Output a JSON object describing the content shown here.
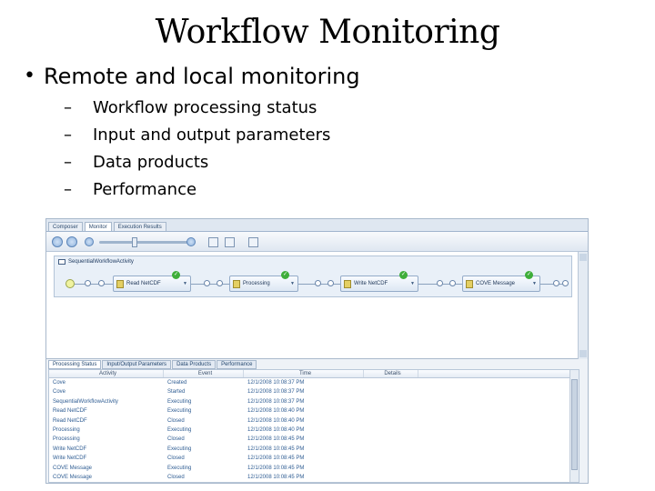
{
  "slide": {
    "title": "Workflow Monitoring",
    "bullet": "Remote and local monitoring",
    "subbullets": [
      "Workflow processing status",
      "Input and output parameters",
      "Data products",
      "Performance"
    ]
  },
  "app": {
    "tabs": [
      "Composer",
      "Monitor",
      "Execution Results"
    ],
    "active_tab": "Monitor",
    "workflow": {
      "name": "SequentialWorkflowActivity",
      "activities": [
        "Read NetCDF",
        "Processing",
        "Write NetCDF",
        "COVE Message"
      ]
    },
    "panel_tabs": [
      "Processing Status",
      "Input/Output Parameters",
      "Data Products",
      "Performance"
    ],
    "grid": {
      "columns": [
        "Activity",
        "Event",
        "Time",
        "Details"
      ],
      "rows": [
        [
          "Cove",
          "Created",
          "12/1/2008 10:08:37 PM",
          ""
        ],
        [
          "Cove",
          "Started",
          "12/1/2008 10:08:37 PM",
          ""
        ],
        [
          "SequentialWorkflowActivity",
          "Executing",
          "12/1/2008 10:08:37 PM",
          ""
        ],
        [
          "Read NetCDF",
          "Executing",
          "12/1/2008 10:08:40 PM",
          ""
        ],
        [
          "Read NetCDF",
          "Closed",
          "12/1/2008 10:08:40 PM",
          ""
        ],
        [
          "Processing",
          "Executing",
          "12/1/2008 10:08:40 PM",
          ""
        ],
        [
          "Processing",
          "Closed",
          "12/1/2008 10:08:45 PM",
          ""
        ],
        [
          "Write NetCDF",
          "Executing",
          "12/1/2008 10:08:45 PM",
          ""
        ],
        [
          "Write NetCDF",
          "Closed",
          "12/1/2008 10:08:45 PM",
          ""
        ],
        [
          "COVE Message",
          "Executing",
          "12/1/2008 10:08:45 PM",
          ""
        ],
        [
          "COVE Message",
          "Closed",
          "12/1/2008 10:08:45 PM",
          ""
        ]
      ]
    }
  }
}
